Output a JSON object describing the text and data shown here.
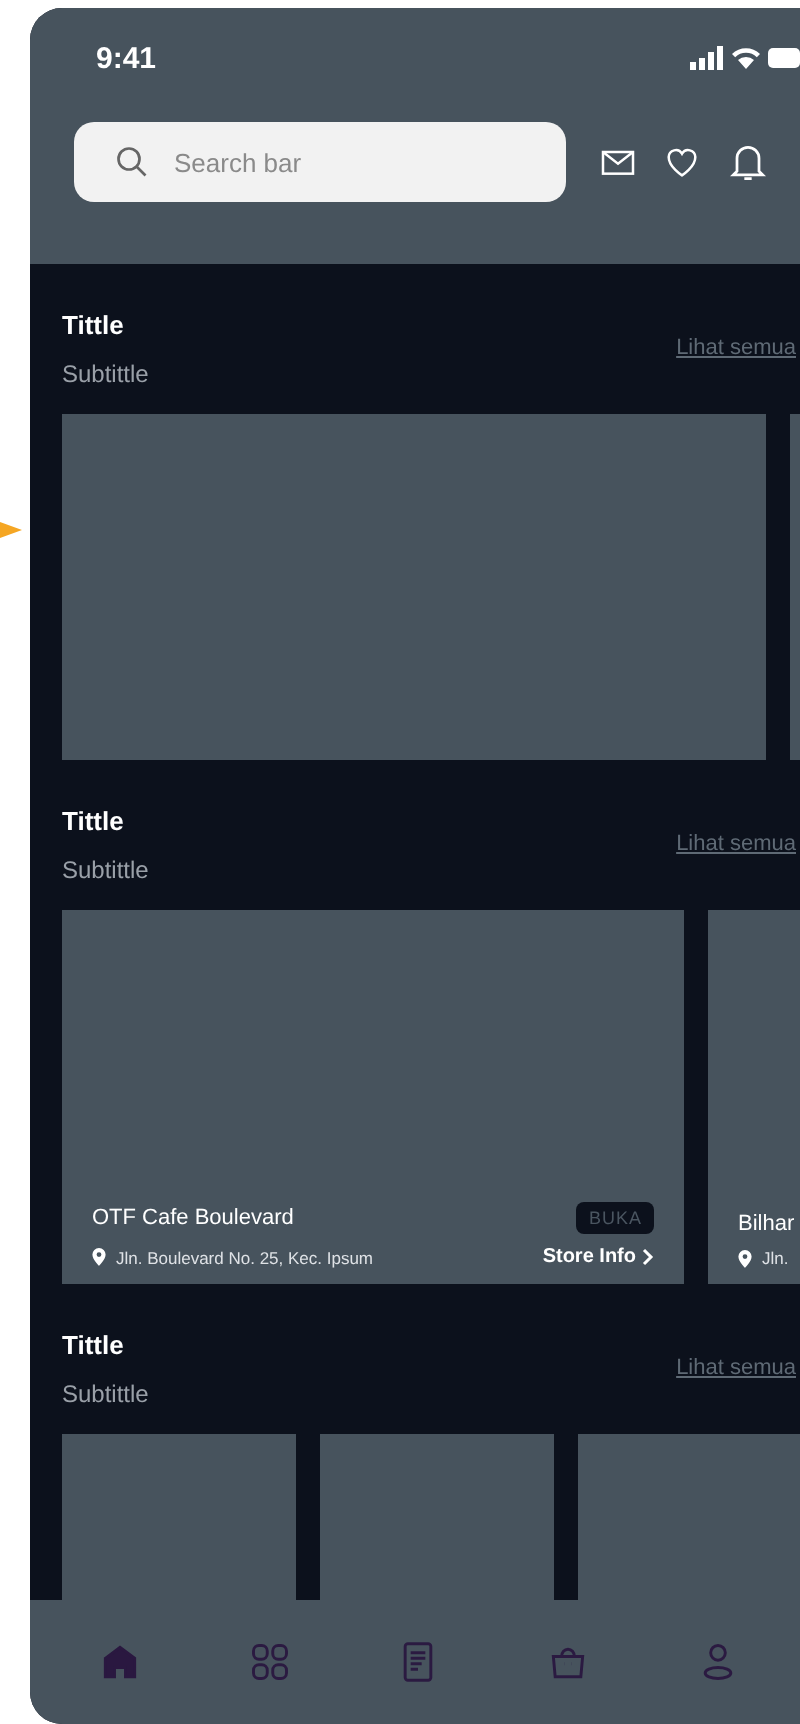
{
  "status_bar": {
    "time": "9:41"
  },
  "search": {
    "placeholder": "Search bar"
  },
  "sections": [
    {
      "kind": "banner",
      "title": "Tittle",
      "subtitle": "Subtittle",
      "link": "Lihat semua"
    },
    {
      "kind": "store",
      "title": "Tittle",
      "subtitle": "Subtittle",
      "link": "Lihat semua",
      "items": [
        {
          "name": "OTF Cafe Boulevard",
          "address": "Jln. Boulevard No. 25, Kec. Ipsum",
          "badge": "BUKA",
          "action": "Store Info"
        },
        {
          "name": "Bilhar",
          "address": "Jln."
        }
      ]
    },
    {
      "kind": "tile",
      "title": "Tittle",
      "subtitle": "Subtittle",
      "link": "Lihat semua"
    }
  ],
  "nav": [
    {
      "kind": "home",
      "selected": true
    },
    {
      "kind": "grid",
      "selected": false
    },
    {
      "kind": "document",
      "selected": false
    },
    {
      "kind": "bag",
      "selected": false
    },
    {
      "kind": "user",
      "selected": false
    }
  ]
}
